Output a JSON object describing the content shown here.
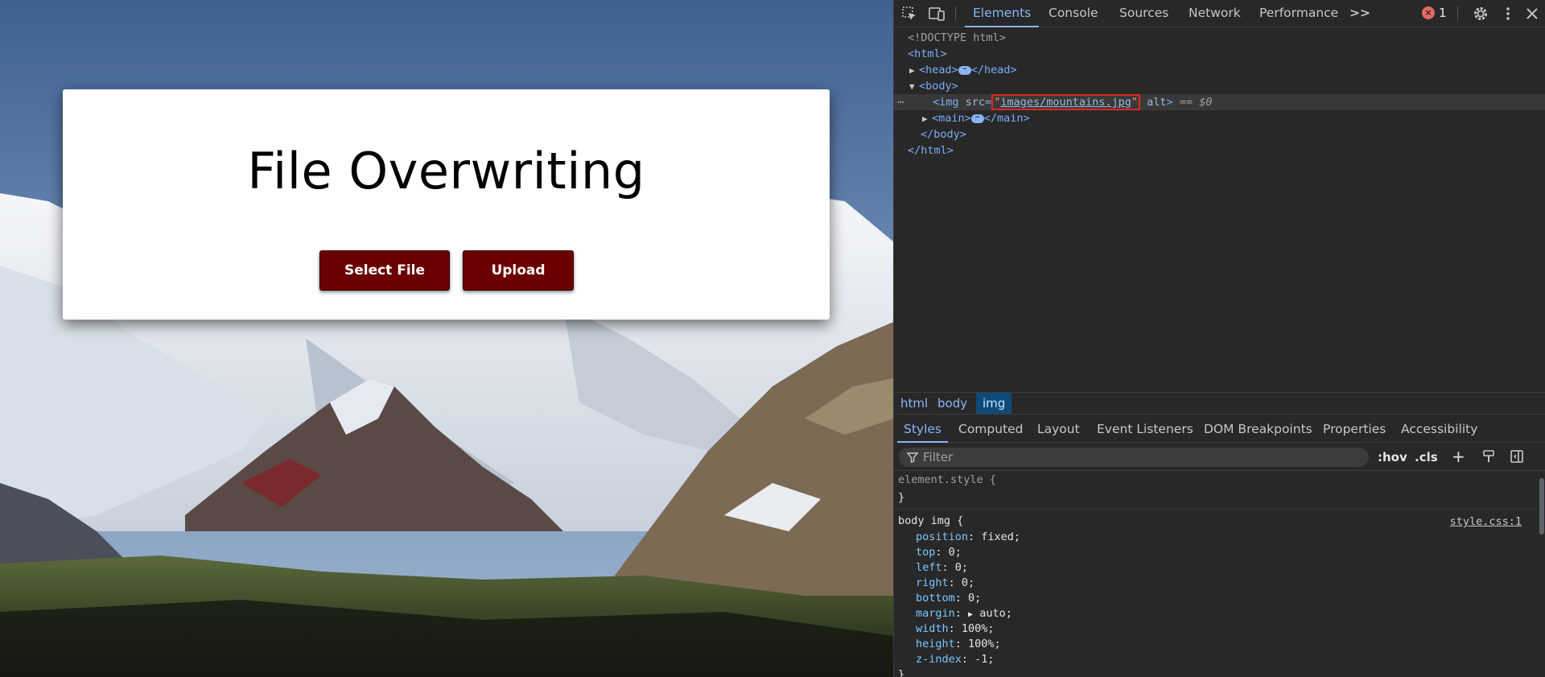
{
  "page": {
    "title": "File Overwriting",
    "buttons": {
      "select": "Select File",
      "upload": "Upload"
    },
    "background_image_name": "mountains-landscape"
  },
  "devtools": {
    "toolbar": {
      "tabs": [
        "Elements",
        "Console",
        "Sources",
        "Network",
        "Performance"
      ],
      "active_tab": "Elements",
      "more_tabs": ">>",
      "error_count": "1"
    },
    "dom": {
      "doctype": "<!DOCTYPE html>",
      "html_open": "<html>",
      "head": "<head>",
      "head_close": "</head>",
      "body_open": "<body>",
      "img_tag": "<img",
      "img_attr_src": "src",
      "img_src_value": "images/mountains.jpg",
      "img_attr_alt": "alt",
      "img_close": ">",
      "selected_marker": "== $0",
      "main_open": "<main>",
      "main_close": "</main>",
      "body_close": "</body>",
      "html_close": "</html>"
    },
    "breadcrumbs": [
      "html",
      "body",
      "img"
    ],
    "active_breadcrumb": "img",
    "sub_tabs": [
      "Styles",
      "Computed",
      "Layout",
      "Event Listeners",
      "DOM Breakpoints",
      "Properties",
      "Accessibility"
    ],
    "active_sub_tab": "Styles",
    "filter": {
      "placeholder": "Filter",
      "hov": ":hov",
      "cls": ".cls"
    },
    "styles": {
      "element_style_open": "element.style {",
      "element_style_close": "}",
      "rule_selector": "body img {",
      "rule_source": "style.css:1",
      "declarations": [
        {
          "prop": "position",
          "value": "fixed;"
        },
        {
          "prop": "top",
          "value": "0;"
        },
        {
          "prop": "left",
          "value": "0;"
        },
        {
          "prop": "right",
          "value": "0;"
        },
        {
          "prop": "bottom",
          "value": "0;"
        },
        {
          "prop": "margin",
          "value": "auto;"
        },
        {
          "prop": "width",
          "value": "100%;"
        },
        {
          "prop": "height",
          "value": "100%;"
        },
        {
          "prop": "z-index",
          "value": "-1;"
        }
      ],
      "rule_close": "}"
    }
  }
}
